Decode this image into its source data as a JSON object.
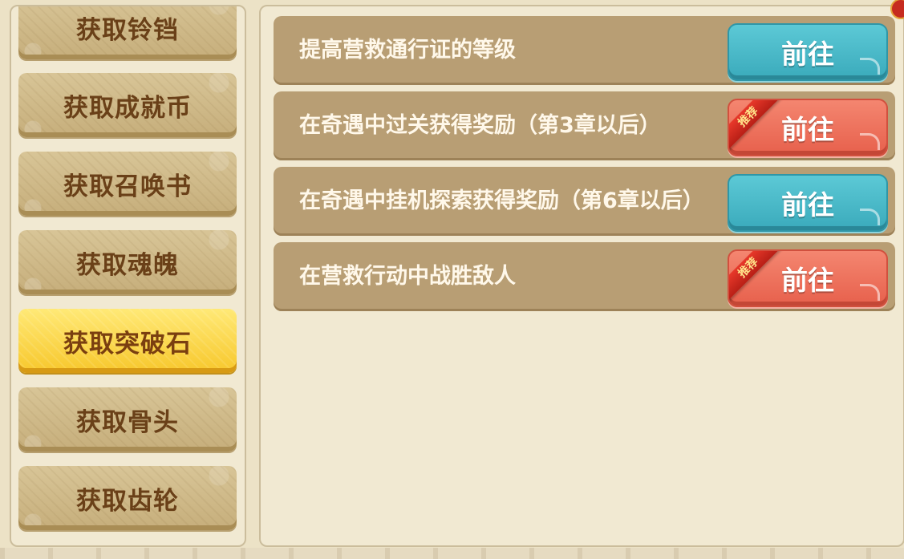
{
  "sidebar": {
    "items": [
      {
        "label": "获取铃铛",
        "active": false
      },
      {
        "label": "获取成就币",
        "active": false
      },
      {
        "label": "获取召唤书",
        "active": false
      },
      {
        "label": "获取魂魄",
        "active": false
      },
      {
        "label": "获取突破石",
        "active": true
      },
      {
        "label": "获取骨头",
        "active": false
      },
      {
        "label": "获取齿轮",
        "active": false
      }
    ]
  },
  "tasks": [
    {
      "text": "提高营救通行证的等级",
      "button": "前往",
      "button_color": "#3aaabb",
      "recommended": false
    },
    {
      "text": "在奇遇中过关获得奖励（第3章以后）",
      "button": "前往",
      "button_color": "#e7604c",
      "recommended": true,
      "ribbon": "推荐"
    },
    {
      "text": "在奇遇中挂机探索获得奖励（第6章以后）",
      "button": "前往",
      "button_color": "#3aaabb",
      "recommended": false
    },
    {
      "text": "在营救行动中战胜敌人",
      "button": "前往",
      "button_color": "#e7604c",
      "recommended": true,
      "ribbon": "推荐"
    }
  ]
}
